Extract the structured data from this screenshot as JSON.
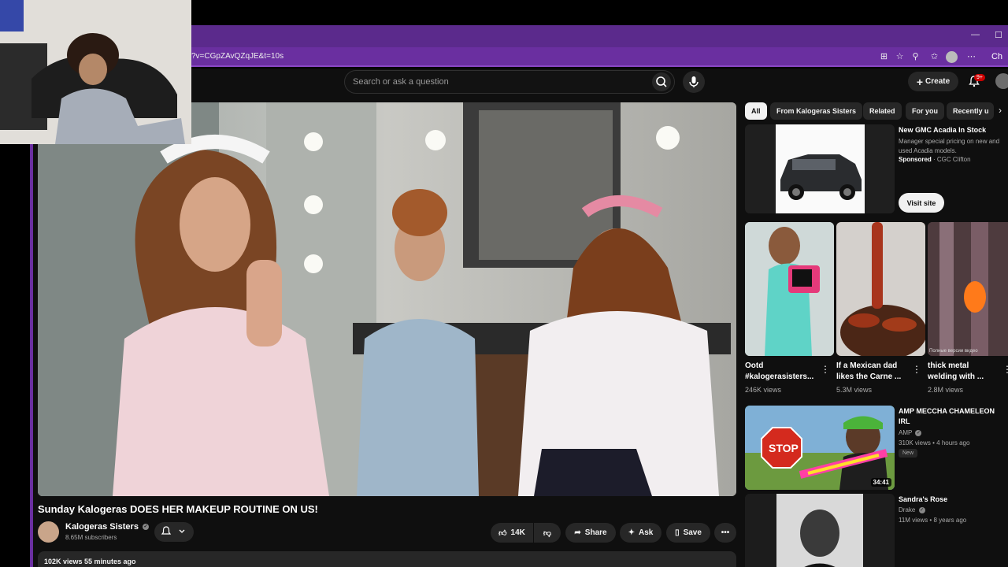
{
  "browser": {
    "url": "?v=CGpZAvQZqJE&t=10s",
    "window_controls": [
      "—",
      "☐"
    ],
    "profile_extension_label": "Ch"
  },
  "youtube": {
    "search_placeholder": "Search or ask a question",
    "create_label": "Create",
    "notification_count": "9+"
  },
  "video": {
    "title": "Sunday Kalogeras DOES HER MAKEUP ROUTINE ON US!",
    "channel": "Kalogeras Sisters",
    "subscribers": "8.65M subscribers",
    "views_time": "102K views  55 minutes ago",
    "actions": {
      "like_count": "14K",
      "share": "Share",
      "ask": "Ask",
      "save": "Save"
    }
  },
  "chips": [
    "All",
    "From Kalogeras Sisters",
    "Related",
    "For you",
    "Recently u"
  ],
  "ad": {
    "title": "New GMC Acadia In Stock",
    "description": "Manager special pricing on new and used Acadia models.",
    "sponsored": "Sponsored",
    "advertiser": " · CGC Clifton",
    "cta": "Visit site"
  },
  "shorts": [
    {
      "title": "Ootd #kalogerasisters...",
      "views": "246K views"
    },
    {
      "title": "If a Mexican dad likes the Carne ...",
      "views": "5.3M views"
    },
    {
      "title": "thick metal welding with ...",
      "views": "2.8M views"
    }
  ],
  "shorts_overlay_text": "Полные версии видео",
  "recommended": [
    {
      "title": "AMP MECCHA CHAMELEON IRL",
      "channel": "AMP",
      "meta": "310K views • 4 hours ago",
      "badge": "New",
      "duration": "34:41"
    },
    {
      "title": "Sandra's Rose",
      "channel": "Drake",
      "meta": "11M views • 8 years ago"
    }
  ],
  "colors": {
    "browser_purple": "#6a2fa0",
    "yt_background": "#0f0f0f",
    "pill_background": "#272727",
    "notification_red": "#cc0000"
  }
}
